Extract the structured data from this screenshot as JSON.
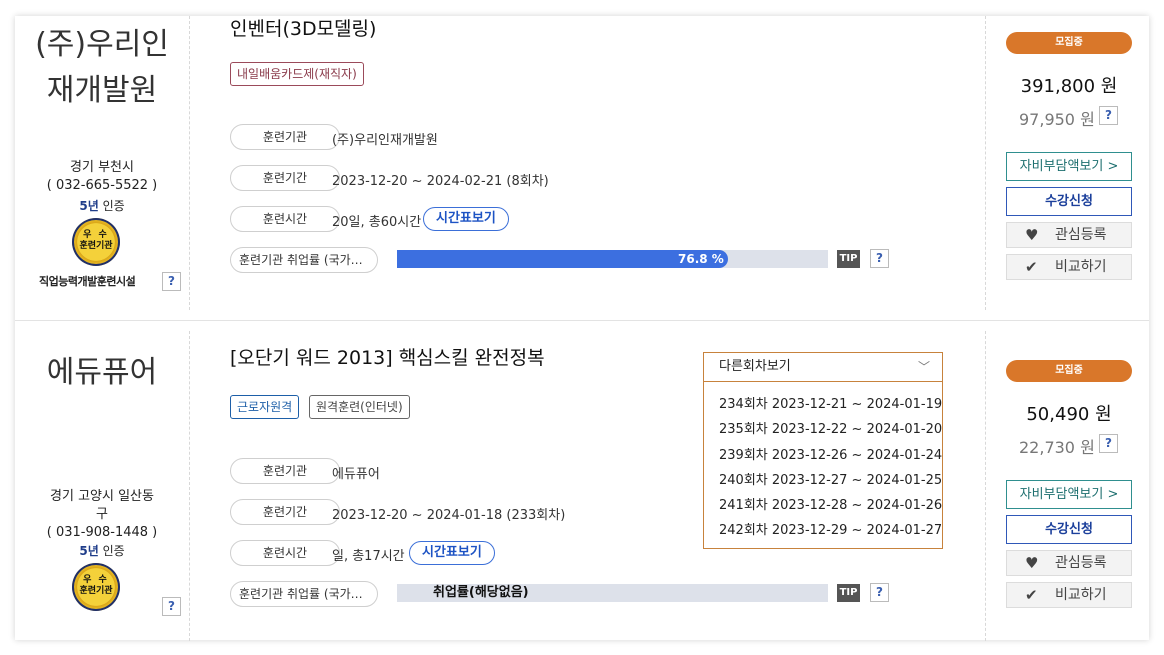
{
  "courses": [
    {
      "org_name": "(주)우리인재개발원",
      "org_name_line1": "(주)우리인",
      "org_name_line2": "재개발원",
      "address": "경기 부천시",
      "phone": "( 032-665-5522 )",
      "cert_years": "5년",
      "cert_label": "인증",
      "medal_top": "우 수",
      "medal_bottom": "훈련기관",
      "facility_label": "직업능력개발훈련시설",
      "title": "인벤터(3D모델링)",
      "tags": [
        "내일배움카드제(재직자)"
      ],
      "info_labels": {
        "org": "훈련기관",
        "period": "훈련기간",
        "hours": "훈련시간",
        "employment": "훈련기관 취업률 (국가…"
      },
      "org_value": "(주)우리인재개발원",
      "period_value": "2023-12-20 ~ 2024-02-21 (8회차)",
      "hours_value": "20일, 총60시간",
      "timetable_label": "시간표보기",
      "employment_rate": 76.8,
      "employment_label": "76.8 %",
      "tip_label": "TIP",
      "help_label": "?",
      "status": "모집중",
      "price": "391,800 원",
      "self_price": "97,950 원",
      "self_burden_label": "자비부담액보기 >",
      "apply_label": "수강신청",
      "wish_label": "관심등록",
      "compare_label": "비교하기"
    },
    {
      "org_name": "에듀퓨어",
      "address_line1": "경기 고양시 일산동",
      "address_line2": "구",
      "phone": "( 031-908-1448 )",
      "cert_years": "5년",
      "cert_label": "인증",
      "medal_top": "우 수",
      "medal_bottom": "훈련기관",
      "title": "[오단기 워드 2013] 핵심스킬 완전정복",
      "tags": [
        "근로자원격",
        "원격훈련(인터넷)"
      ],
      "info_labels": {
        "org": "훈련기관",
        "period": "훈련기간",
        "hours": "훈련시간",
        "employment": "훈련기관 취업률 (국가…"
      },
      "org_value": "에듀퓨어",
      "period_value": "2023-12-20 ~ 2024-01-18 (233회차)",
      "hours_value": "일, 총17시간",
      "timetable_label": "시간표보기",
      "employment_label": "취업률(해당없음)",
      "tip_label": "TIP",
      "help_label": "?",
      "status": "모집중",
      "price": "50,490 원",
      "self_price": "22,730 원",
      "self_burden_label": "자비부담액보기 >",
      "apply_label": "수강신청",
      "wish_label": "관심등록",
      "compare_label": "비교하기",
      "sessions_dropdown": {
        "label": "다른회차보기",
        "items": [
          "234회차 2023-12-21 ~ 2024-01-19",
          "235회차 2023-12-22 ~ 2024-01-20",
          "239회차 2023-12-26 ~ 2024-01-24",
          "240회차 2023-12-27 ~ 2024-01-25",
          "241회차 2023-12-28 ~ 2024-01-26",
          "242회차 2023-12-29 ~ 2024-01-27"
        ]
      }
    }
  ],
  "icons": {
    "heart": "heart-icon",
    "check": "check-icon",
    "chevron": "chevron-down-icon"
  },
  "colors": {
    "status": "#d9772a",
    "bar": "#3c6fe0",
    "accent": "#1d53c4",
    "teal": "#1d6f6f"
  }
}
